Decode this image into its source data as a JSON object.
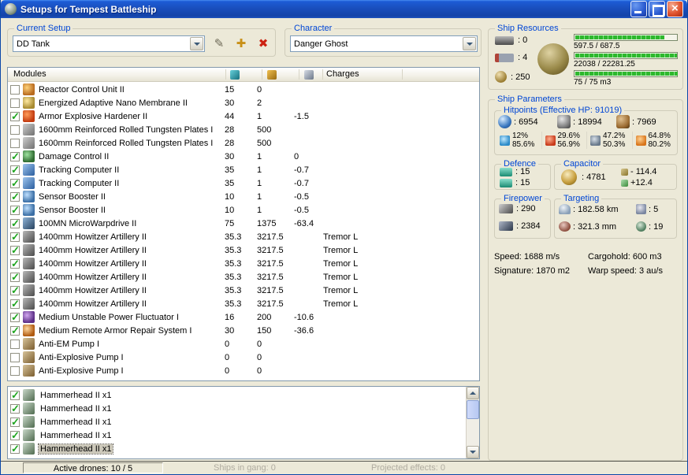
{
  "window": {
    "title": "Setups for Tempest Battleship"
  },
  "colors": {
    "titlebar_blue": "#1a50c0",
    "body_background": "#ece9d8",
    "group_label_blue": "#0046d5",
    "bar_green": "#2eb82e",
    "check_green": "#1fa51f",
    "close_red": "#e0532f",
    "disabled_gray": "#b0aca0"
  },
  "current_setup": {
    "label": "Current Setup",
    "value": "DD Tank"
  },
  "character": {
    "label": "Character",
    "value": "Danger Ghost"
  },
  "ship_resources": {
    "label": "Ship Resources",
    "turret_hardpoints": ": 0",
    "launcher_hardpoints": ": 4",
    "calibration": ": 250",
    "bars": [
      {
        "name": "cpu",
        "text": "597.5 / 687.5",
        "pct": 87
      },
      {
        "name": "powergrid",
        "text": "22038 / 22281.25",
        "pct": 99
      },
      {
        "name": "dronebay",
        "text": "75 / 75 m3",
        "pct": 100
      }
    ]
  },
  "modules": {
    "header_title": "Modules",
    "header_charges": "Charges",
    "rows": [
      {
        "checked": false,
        "icon": "reactor-control-icon",
        "name": "Reactor Control Unit II",
        "cpu": "15",
        "pg": "0",
        "cap": "",
        "charge": ""
      },
      {
        "checked": false,
        "icon": "nano-membrane-icon",
        "name": "Energized Adaptive Nano Membrane II",
        "cpu": "30",
        "pg": "2",
        "cap": "",
        "charge": ""
      },
      {
        "checked": true,
        "icon": "armor-hardener-icon",
        "name": "Armor Explosive Hardener II",
        "cpu": "44",
        "pg": "1",
        "cap": "-1.5",
        "charge": ""
      },
      {
        "checked": false,
        "icon": "armor-plates-icon",
        "name": "1600mm Reinforced Rolled Tungsten Plates I",
        "cpu": "28",
        "pg": "500",
        "cap": "",
        "charge": ""
      },
      {
        "checked": false,
        "icon": "armor-plates-icon",
        "name": "1600mm Reinforced Rolled Tungsten Plates I",
        "cpu": "28",
        "pg": "500",
        "cap": "",
        "charge": ""
      },
      {
        "checked": true,
        "icon": "damage-control-icon",
        "name": "Damage Control II",
        "cpu": "30",
        "pg": "1",
        "cap": "0",
        "charge": ""
      },
      {
        "checked": true,
        "icon": "tracking-computer-icon",
        "name": "Tracking Computer II",
        "cpu": "35",
        "pg": "1",
        "cap": "-0.7",
        "charge": ""
      },
      {
        "checked": true,
        "icon": "tracking-computer-icon",
        "name": "Tracking Computer II",
        "cpu": "35",
        "pg": "1",
        "cap": "-0.7",
        "charge": ""
      },
      {
        "checked": true,
        "icon": "sensor-booster-icon",
        "name": "Sensor Booster II",
        "cpu": "10",
        "pg": "1",
        "cap": "-0.5",
        "charge": ""
      },
      {
        "checked": true,
        "icon": "sensor-booster-icon",
        "name": "Sensor Booster II",
        "cpu": "10",
        "pg": "1",
        "cap": "-0.5",
        "charge": ""
      },
      {
        "checked": true,
        "icon": "mwd-icon",
        "name": "100MN MicroWarpdrive II",
        "cpu": "75",
        "pg": "1375",
        "cap": "-63.4",
        "charge": ""
      },
      {
        "checked": true,
        "icon": "artillery-icon",
        "name": "1400mm Howitzer Artillery II",
        "cpu": "35.3",
        "pg": "3217.5",
        "cap": "",
        "charge": "Tremor L"
      },
      {
        "checked": true,
        "icon": "artillery-icon",
        "name": "1400mm Howitzer Artillery II",
        "cpu": "35.3",
        "pg": "3217.5",
        "cap": "",
        "charge": "Tremor L"
      },
      {
        "checked": true,
        "icon": "artillery-icon",
        "name": "1400mm Howitzer Artillery II",
        "cpu": "35.3",
        "pg": "3217.5",
        "cap": "",
        "charge": "Tremor L"
      },
      {
        "checked": true,
        "icon": "artillery-icon",
        "name": "1400mm Howitzer Artillery II",
        "cpu": "35.3",
        "pg": "3217.5",
        "cap": "",
        "charge": "Tremor L"
      },
      {
        "checked": true,
        "icon": "artillery-icon",
        "name": "1400mm Howitzer Artillery II",
        "cpu": "35.3",
        "pg": "3217.5",
        "cap": "",
        "charge": "Tremor L"
      },
      {
        "checked": true,
        "icon": "artillery-icon",
        "name": "1400mm Howitzer Artillery II",
        "cpu": "35.3",
        "pg": "3217.5",
        "cap": "",
        "charge": "Tremor L"
      },
      {
        "checked": true,
        "icon": "neutralizer-icon",
        "name": "Medium Unstable Power Fluctuator I",
        "cpu": "16",
        "pg": "200",
        "cap": "-10.6",
        "charge": ""
      },
      {
        "checked": true,
        "icon": "remote-repair-icon",
        "name": "Medium Remote Armor Repair System I",
        "cpu": "30",
        "pg": "150",
        "cap": "-36.6",
        "charge": ""
      },
      {
        "checked": false,
        "icon": "rig-icon",
        "name": "Anti-EM Pump I",
        "cpu": "0",
        "pg": "0",
        "cap": "",
        "charge": ""
      },
      {
        "checked": false,
        "icon": "rig-icon",
        "name": "Anti-Explosive Pump I",
        "cpu": "0",
        "pg": "0",
        "cap": "",
        "charge": ""
      },
      {
        "checked": false,
        "icon": "rig-icon",
        "name": "Anti-Explosive Pump I",
        "cpu": "0",
        "pg": "0",
        "cap": "",
        "charge": ""
      }
    ]
  },
  "drones": {
    "rows": [
      {
        "checked": true,
        "name": "Hammerhead II x1",
        "selected": false
      },
      {
        "checked": true,
        "name": "Hammerhead II x1",
        "selected": false
      },
      {
        "checked": true,
        "name": "Hammerhead II x1",
        "selected": false
      },
      {
        "checked": true,
        "name": "Hammerhead II x1",
        "selected": false
      },
      {
        "checked": true,
        "name": "Hammerhead II x1",
        "selected": true
      }
    ]
  },
  "statusbar": {
    "active_drones": "Active drones: 10 / 5",
    "ships_in_gang": "Ships in gang: 0",
    "projected_effects": "Projected effects: 0"
  },
  "ship_parameters": {
    "label": "Ship Parameters",
    "hitpoints": {
      "label": "Hitpoints (Effective HP: 91019)",
      "shield": ": 6954",
      "armor": ": 18994",
      "structure": ": 7969",
      "resists": [
        {
          "type": "em",
          "shield": "12%",
          "armor": "85.6%"
        },
        {
          "type": "thermal",
          "shield": "29.6%",
          "armor": "56.9%"
        },
        {
          "type": "kinetic",
          "shield": "47.2%",
          "armor": "50.3%"
        },
        {
          "type": "explosive",
          "shield": "64.8%",
          "armor": "80.2%"
        }
      ]
    },
    "defence": {
      "label": "Defence",
      "shield_rate": ": 15",
      "armor_rate": ": 15"
    },
    "capacitor": {
      "label": "Capacitor",
      "amount": ": 4781",
      "drain": "- 114.4",
      "recharge": "+12.4"
    },
    "firepower": {
      "label": "Firepower",
      "dps": ": 290",
      "volley": ": 2384"
    },
    "targeting": {
      "label": "Targeting",
      "range": ": 182.58 km",
      "max_targets": ": 5",
      "sig_resolution": ": 321.3 mm",
      "scan_resolution": ": 19"
    },
    "speed": "Speed: 1688 m/s",
    "cargohold": "Cargohold: 600 m3",
    "signature": "Signature: 1870 m2",
    "warp_speed": "Warp speed: 3 au/s"
  }
}
